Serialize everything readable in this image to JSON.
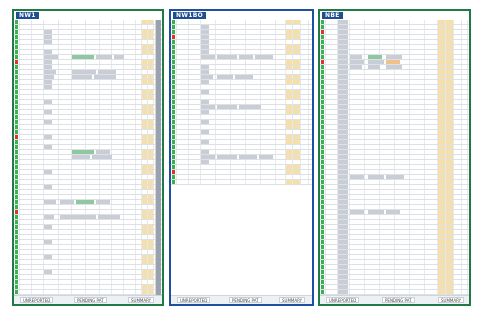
{
  "panels": [
    {
      "id": "left",
      "title": "NW1",
      "tabs": [
        "UNREPORTED",
        "PENDING PAT",
        "SUMMARY"
      ],
      "active_tab": 2
    },
    {
      "id": "middle",
      "title": "NW1BO",
      "tabs": [
        "UNREPORTED",
        "PENDING PAT",
        "SUMMARY"
      ],
      "active_tab": 2
    },
    {
      "id": "right",
      "title": "NBE",
      "tabs": [
        "UNREPORTED",
        "PENDING PAT",
        "SUMMARY"
      ],
      "active_tab": 2
    }
  ],
  "colors": {
    "frame_green": "#1f7a47",
    "frame_blue": "#1f4fa0",
    "header_bg": "#1f4f8f",
    "status_green": "#37b24d",
    "status_red": "#e03131",
    "highlight": "#f7dfa8"
  }
}
